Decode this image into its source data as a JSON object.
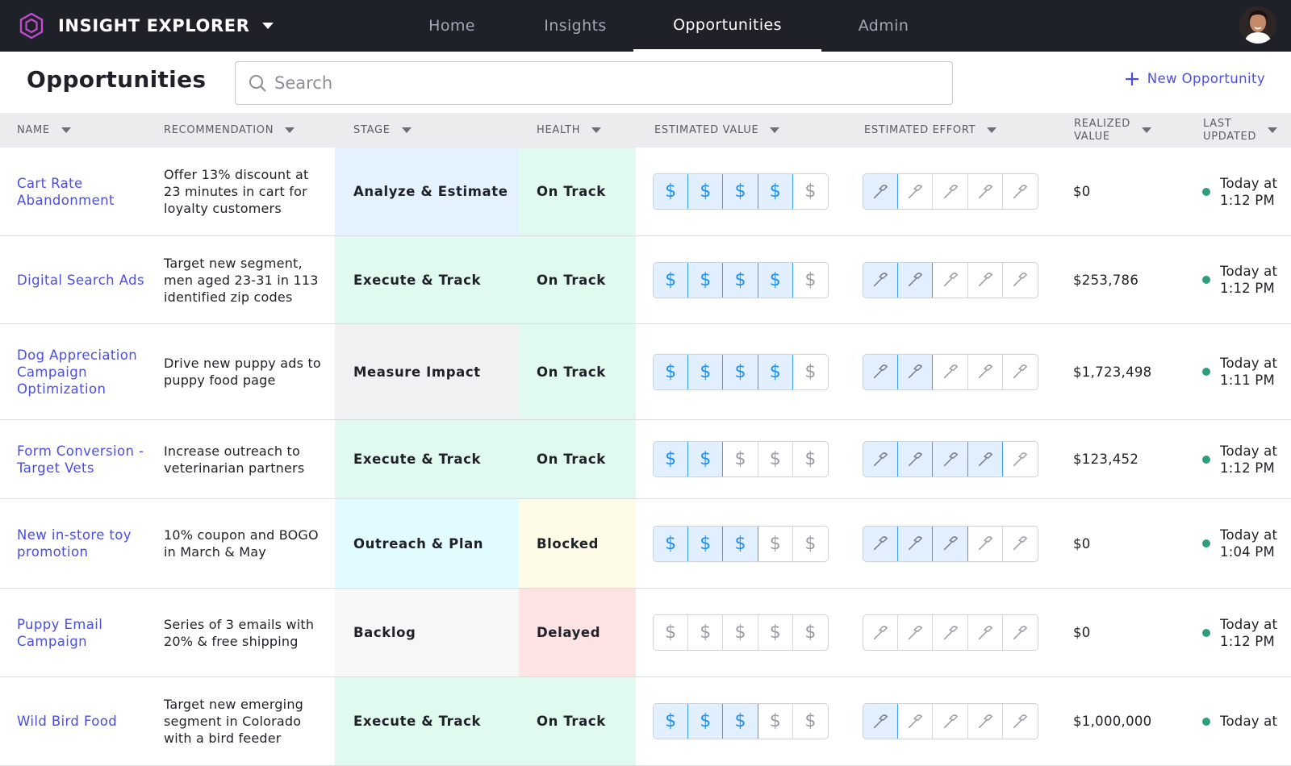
{
  "app": {
    "title": "INSIGHT EXPLORER",
    "nav_tabs": [
      "Home",
      "Insights",
      "Opportunities",
      "Admin"
    ],
    "active_tab": "Opportunities"
  },
  "page": {
    "title": "Opportunities",
    "search_placeholder": "Search",
    "new_button_label": "New Opportunity"
  },
  "columns": [
    "NAME",
    "RECOMMENDATION",
    "STAGE",
    "HEALTH",
    "ESTIMATED VALUE",
    "ESTIMATED EFFORT",
    "REALIZED\nVALUE",
    "LAST\nUPDATED"
  ],
  "colors": {
    "accent": "#4a4ee3",
    "nav_bg": "#1f2129",
    "value_on": "#1f8ff0",
    "status_dot": "#2e9e7c"
  },
  "stage_colors": {
    "Analyze & Estimate": "#e4f2ff",
    "Execute & Track": "#e0faf0",
    "Measure Impact": "#f0f1f3",
    "Outreach & Plan": "#e2fbff",
    "Backlog": "#f7f7f8"
  },
  "health_colors": {
    "On Track": "#e0faf0",
    "Blocked": "#fefce6",
    "Delayed": "#fde3e3"
  },
  "rows": [
    {
      "name": "Cart Rate Abandonment",
      "recommendation": "Offer 13% discount at 23 minutes in cart for loyalty customers",
      "stage": "Analyze & Estimate",
      "health": "On Track",
      "estimated_value": 4,
      "estimated_effort": 1,
      "realized_value": "$0",
      "last_updated": "Today at 1:12 PM"
    },
    {
      "name": "Digital Search Ads",
      "recommendation": "Target new segment, men aged 23-31 in 113 identified zip codes",
      "stage": "Execute & Track",
      "health": "On Track",
      "estimated_value": 4,
      "estimated_effort": 2,
      "realized_value": "$253,786",
      "last_updated": "Today at 1:12 PM"
    },
    {
      "name": "Dog Appreciation Campaign Optimization",
      "recommendation": "Drive new puppy ads to puppy food page",
      "stage": "Measure Impact",
      "health": "On Track",
      "estimated_value": 4,
      "estimated_effort": 2,
      "realized_value": "$1,723,498",
      "last_updated": "Today at 1:11 PM"
    },
    {
      "name": "Form Conversion - Target Vets",
      "recommendation": "Increase outreach to veterinarian partners",
      "stage": "Execute & Track",
      "health": "On Track",
      "estimated_value": 2,
      "estimated_effort": 4,
      "realized_value": "$123,452",
      "last_updated": "Today at 1:12 PM"
    },
    {
      "name": "New in-store toy promotion",
      "recommendation": "10% coupon and BOGO in March & May",
      "stage": "Outreach & Plan",
      "health": "Blocked",
      "estimated_value": 3,
      "estimated_effort": 3,
      "realized_value": "$0",
      "last_updated": "Today at 1:04 PM"
    },
    {
      "name": "Puppy Email Campaign",
      "recommendation": "Series of 3 emails with 20% & free shipping",
      "stage": "Backlog",
      "health": "Delayed",
      "estimated_value": 0,
      "estimated_effort": 0,
      "realized_value": "$0",
      "last_updated": "Today at 1:12 PM"
    },
    {
      "name": "Wild Bird Food",
      "recommendation": "Target new emerging segment in Colorado with a bird feeder",
      "stage": "Execute & Track",
      "health": "On Track",
      "estimated_value": 3,
      "estimated_effort": 1,
      "realized_value": "$1,000,000",
      "last_updated": "Today at"
    }
  ]
}
